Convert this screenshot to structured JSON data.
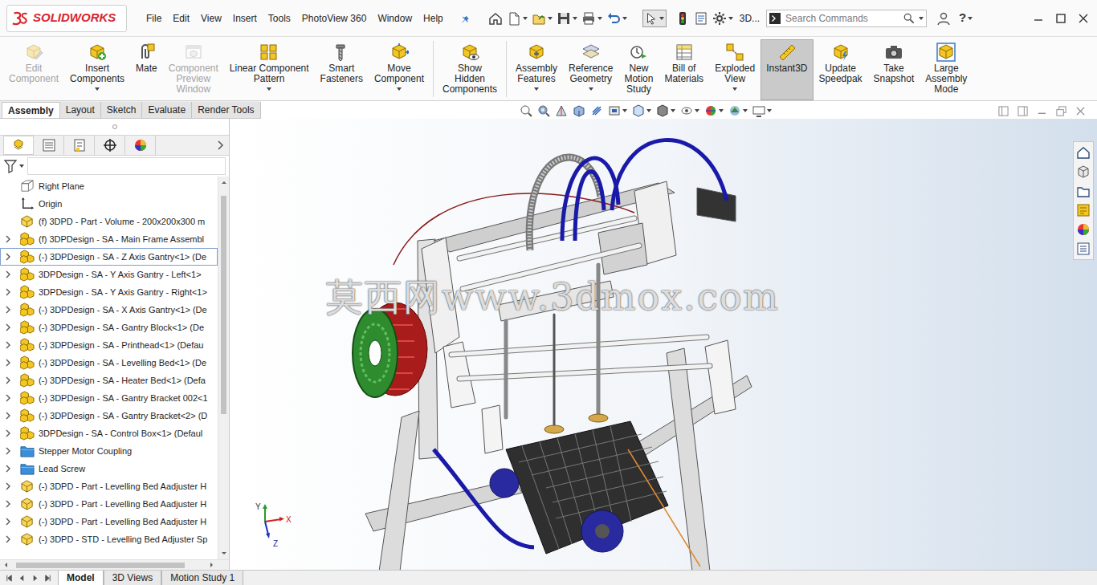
{
  "app": {
    "logo_text": "SOLIDWORKS"
  },
  "menu": [
    "File",
    "Edit",
    "View",
    "Insert",
    "Tools",
    "PhotoView 360",
    "Window",
    "Help"
  ],
  "toolbar": {
    "overflow": "3D...",
    "help": "?"
  },
  "search": {
    "placeholder": "Search Commands"
  },
  "ribbon": {
    "groups": [
      {
        "items": [
          {
            "lines": [
              "Edit",
              "Component"
            ],
            "disabled": true,
            "selected": false,
            "dropdown": false
          },
          {
            "lines": [
              "Insert",
              "Components"
            ],
            "disabled": false,
            "selected": false,
            "dropdown": true
          },
          {
            "lines": [
              "Mate"
            ],
            "disabled": false,
            "selected": false,
            "dropdown": false
          },
          {
            "lines": [
              "Component",
              "Preview",
              "Window"
            ],
            "disabled": true,
            "selected": false,
            "dropdown": false
          },
          {
            "lines": [
              "Linear Component",
              "Pattern"
            ],
            "disabled": false,
            "selected": false,
            "dropdown": true
          },
          {
            "lines": [
              "Smart",
              "Fasteners"
            ],
            "disabled": false,
            "selected": false,
            "dropdown": false
          },
          {
            "lines": [
              "Move",
              "Component"
            ],
            "disabled": false,
            "selected": false,
            "dropdown": true
          }
        ]
      },
      {
        "items": [
          {
            "lines": [
              "Show",
              "Hidden",
              "Components"
            ],
            "disabled": false,
            "selected": false,
            "dropdown": false
          }
        ]
      },
      {
        "items": [
          {
            "lines": [
              "Assembly",
              "Features"
            ],
            "disabled": false,
            "selected": false,
            "dropdown": true
          },
          {
            "lines": [
              "Reference",
              "Geometry"
            ],
            "disabled": false,
            "selected": false,
            "dropdown": true
          },
          {
            "lines": [
              "New",
              "Motion",
              "Study"
            ],
            "disabled": false,
            "selected": false,
            "dropdown": false
          },
          {
            "lines": [
              "Bill of",
              "Materials"
            ],
            "disabled": false,
            "selected": false,
            "dropdown": false
          },
          {
            "lines": [
              "Exploded",
              "View"
            ],
            "disabled": false,
            "selected": false,
            "dropdown": true
          },
          {
            "lines": [
              "Instant3D"
            ],
            "disabled": false,
            "selected": true,
            "dropdown": false
          },
          {
            "lines": [
              "Update",
              "Speedpak"
            ],
            "disabled": false,
            "selected": false,
            "dropdown": false
          },
          {
            "lines": [
              "Take",
              "Snapshot"
            ],
            "disabled": false,
            "selected": false,
            "dropdown": false
          },
          {
            "lines": [
              "Large",
              "Assembly",
              "Mode"
            ],
            "disabled": false,
            "selected": false,
            "dropdown": false
          }
        ]
      }
    ]
  },
  "command_tabs": [
    {
      "label": "Assembly",
      "selected": true
    },
    {
      "label": "Layout",
      "selected": false
    },
    {
      "label": "Sketch",
      "selected": false
    },
    {
      "label": "Evaluate",
      "selected": false
    },
    {
      "label": "Render Tools",
      "selected": false
    }
  ],
  "panel_tabs": [
    {
      "selected": true
    },
    {
      "selected": false
    },
    {
      "selected": false
    },
    {
      "selected": false
    },
    {
      "selected": false
    }
  ],
  "feature_tree": {
    "items": [
      {
        "label": "Right Plane",
        "kind": "plane",
        "expandable": false,
        "selected": false
      },
      {
        "label": "Origin",
        "kind": "origin",
        "expandable": false,
        "selected": false
      },
      {
        "label": "(f) 3DPD - Part - Volume - 200x200x300 m",
        "kind": "part",
        "expandable": false,
        "selected": false
      },
      {
        "label": "(f) 3DPDesign - SA - Main Frame Assembl",
        "kind": "assembly",
        "expandable": true,
        "selected": false
      },
      {
        "label": "(-) 3DPDesign - SA - Z Axis Gantry<1> (De",
        "kind": "assembly",
        "expandable": true,
        "selected": true
      },
      {
        "label": "3DPDesign - SA - Y Axis Gantry - Left<1>",
        "kind": "assembly",
        "expandable": true,
        "selected": false
      },
      {
        "label": "3DPDesign - SA - Y Axis Gantry - Right<1>",
        "kind": "assembly",
        "expandable": true,
        "selected": false
      },
      {
        "label": "(-) 3DPDesign - SA - X Axis Gantry<1> (De",
        "kind": "assembly",
        "expandable": true,
        "selected": false
      },
      {
        "label": "(-) 3DPDesign - SA - Gantry Block<1> (De",
        "kind": "assembly",
        "expandable": true,
        "selected": false
      },
      {
        "label": "(-) 3DPDesign - SA - Printhead<1> (Defau",
        "kind": "assembly",
        "expandable": true,
        "selected": false
      },
      {
        "label": "(-) 3DPDesign - SA - Levelling Bed<1> (De",
        "kind": "assembly",
        "expandable": true,
        "selected": false
      },
      {
        "label": "(-) 3DPDesign - SA - Heater Bed<1> (Defa",
        "kind": "assembly",
        "expandable": true,
        "selected": false
      },
      {
        "label": "(-) 3DPDesign - SA - Gantry Bracket 002<1",
        "kind": "assembly",
        "expandable": true,
        "selected": false
      },
      {
        "label": "(-) 3DPDesign - SA - Gantry Bracket<2> (D",
        "kind": "assembly",
        "expandable": true,
        "selected": false
      },
      {
        "label": "3DPDesign - SA - Control Box<1> (Defaul",
        "kind": "assembly",
        "expandable": true,
        "selected": false
      },
      {
        "label": "Stepper Motor Coupling",
        "kind": "folder",
        "expandable": true,
        "selected": false
      },
      {
        "label": "Lead Screw",
        "kind": "folder",
        "expandable": true,
        "selected": false
      },
      {
        "label": "(-) 3DPD - Part - Levelling Bed Aadjuster H",
        "kind": "part",
        "expandable": true,
        "selected": false
      },
      {
        "label": "(-) 3DPD - Part - Levelling Bed Aadjuster H",
        "kind": "part",
        "expandable": true,
        "selected": false
      },
      {
        "label": "(-) 3DPD - Part - Levelling Bed Aadjuster H",
        "kind": "part",
        "expandable": true,
        "selected": false
      },
      {
        "label": "(-) 3DPD - STD - Levelling Bed Adjuster Sp",
        "kind": "part",
        "expandable": true,
        "selected": false
      }
    ]
  },
  "viewport": {
    "watermark": "莫西网www.3dmox.com",
    "triad": {
      "x": "X",
      "y": "Y",
      "z": "Z"
    }
  },
  "bottom_tabs": [
    {
      "label": "Model",
      "selected": true
    },
    {
      "label": "3D Views",
      "selected": false
    },
    {
      "label": "Motion Study 1",
      "selected": false
    }
  ]
}
